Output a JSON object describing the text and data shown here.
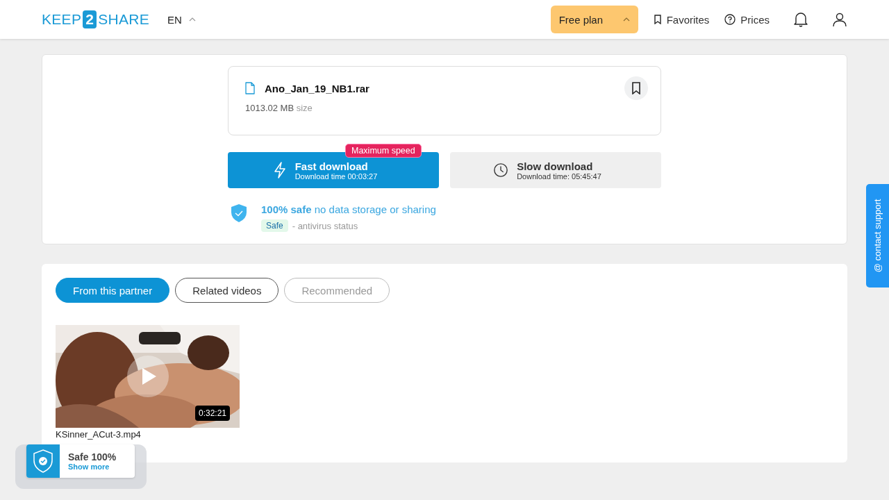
{
  "header": {
    "logo": {
      "left": "KEEP",
      "badge": "2",
      "right": "SHARE"
    },
    "language": "EN",
    "plan": "Free plan",
    "nav": [
      {
        "kind": "favorites",
        "label": "Favorites"
      },
      {
        "kind": "prices",
        "label": "Prices"
      }
    ]
  },
  "file": {
    "name": "Ano_Jan_19_NB1.rar",
    "size": "1013.02 MB",
    "size_label": "size"
  },
  "downloads": [
    {
      "kind": "fast",
      "title": "Fast download",
      "subtitle": "Download time 00:03:27",
      "badge": "Maximum speed"
    },
    {
      "kind": "slow",
      "title": "Slow download",
      "subtitle": "Download time: 05:45:47"
    }
  ],
  "safety": {
    "headline": "**100% safe** no data storage or sharing",
    "status": "Safe",
    "status_note": "- antivirus status"
  },
  "tabs": [
    {
      "label": "From this partner",
      "selected": true,
      "disabled": false
    },
    {
      "label": "Related videos",
      "selected": false,
      "disabled": false
    },
    {
      "label": "Recommended",
      "selected": false,
      "disabled": true
    }
  ],
  "videos": [
    {
      "kind": "picture",
      "duration": "0:32:21",
      "title": "KSinner_ACut-3.mp4"
    }
  ],
  "support_tab": "@ contact support",
  "safe_widget": {
    "title": "Safe 100%",
    "link": "Show more"
  }
}
